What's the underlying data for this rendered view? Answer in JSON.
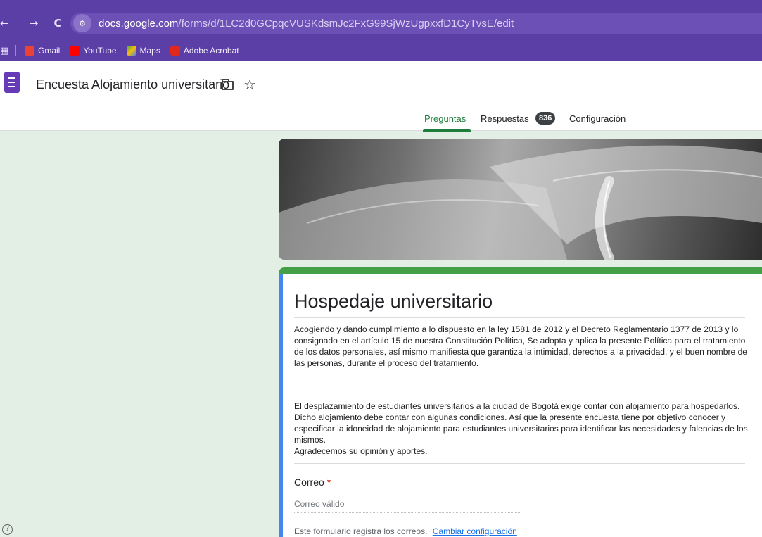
{
  "browser": {
    "nav": {
      "back_icon": "←",
      "forward_icon": "→",
      "reload_icon": "C"
    },
    "url": {
      "host": "docs.google.com",
      "path": "/forms/d/1LC2d0GCpqcVUSKdsmJc2FxG99SjWzUgpxxfD1CyTvsE/edit"
    },
    "bookmarks": [
      {
        "label": "Gmail",
        "icon": "gmail-icon",
        "color": "#ea4335"
      },
      {
        "label": "YouTube",
        "icon": "youtube-icon",
        "color": "#ff0000"
      },
      {
        "label": "Maps",
        "icon": "maps-icon",
        "color": "#34a853"
      },
      {
        "label": "Adobe Acrobat",
        "icon": "acrobat-icon",
        "color": "#e0281d"
      }
    ]
  },
  "header": {
    "doc_title": "Encuesta Alojamiento universitario",
    "tabs": {
      "preguntas": "Preguntas",
      "respuestas": "Respuestas",
      "respuestas_count": "836",
      "configuracion": "Configuración"
    },
    "accent_color": "#1e7d3a"
  },
  "form": {
    "title": "Hospedaje universitario",
    "description_1": "Acogiendo y dando cumplimiento a lo dispuesto en la ley 1581 de 2012 y el Decreto Reglamentario 1377 de 2013 y lo consignado en el artículo 15 de nuestra Constitución Política, Se adopta y aplica la presente Política para el tratamiento de los datos personales, así mismo manifiesta que garantiza la intimidad, derechos a la privacidad, y el buen nombre de las personas, durante el proceso del tratamiento.",
    "description_2": "El desplazamiento de estudiantes universitarios a la ciudad de Bogotá exige contar con alojamiento para hospedarlos. Dicho alojamiento debe contar con algunas condiciones. Así que la presente encuesta tiene por objetivo conocer y especificar la idoneidad de alojamiento para estudiantes universitarios para identificar las necesidades y falencias de los mismos.",
    "description_3": "Agradecemos su opinión y aportes.",
    "question": {
      "label": "Correo",
      "required_mark": "*",
      "placeholder": "Correo válido",
      "note": "Este formulario registra los correos.",
      "note_link": "Cambiar configuración"
    },
    "theme_colors": {
      "top_bar": "#43a047",
      "focus_bar": "#4285f4",
      "background": "#e3efe4"
    }
  },
  "help": {
    "icon": "help-icon",
    "glyph": "?"
  }
}
